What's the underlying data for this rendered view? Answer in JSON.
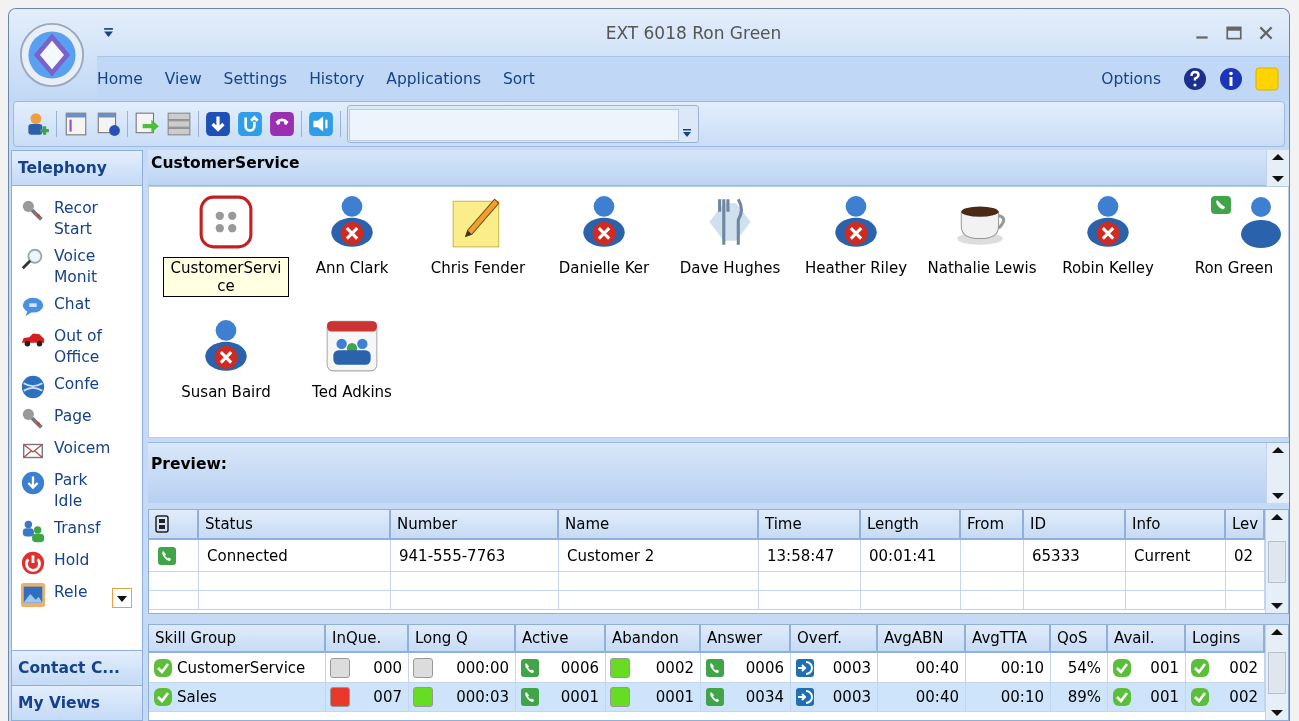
{
  "window": {
    "title": "EXT 6018 Ron Green"
  },
  "menu": [
    "Home",
    "View",
    "Settings",
    "History",
    "Applications",
    "Sort"
  ],
  "options": "Options",
  "sidebar": {
    "active_section": "Telephony",
    "items": [
      {
        "kind": "microphone",
        "lines": [
          "Recor",
          "Start"
        ]
      },
      {
        "kind": "magnifier",
        "lines": [
          "Voice",
          "Monit"
        ]
      },
      {
        "kind": "chat",
        "lines": [
          "Chat"
        ]
      },
      {
        "kind": "car",
        "lines": [
          "Out of",
          "Office"
        ]
      },
      {
        "kind": "conference",
        "lines": [
          "Confe"
        ]
      },
      {
        "kind": "microphone",
        "lines": [
          "Page"
        ]
      },
      {
        "kind": "envelope",
        "lines": [
          "Voicem"
        ]
      },
      {
        "kind": "park",
        "lines": [
          "Park",
          "Idle"
        ]
      },
      {
        "kind": "transfer",
        "lines": [
          "Transf"
        ]
      },
      {
        "kind": "hold",
        "lines": [
          "Hold"
        ]
      },
      {
        "kind": "release",
        "lines": [
          "Rele"
        ]
      }
    ],
    "other_sections": [
      "Contact C...",
      "My Views"
    ]
  },
  "group_panel": {
    "title": "CustomerService",
    "contacts": [
      {
        "name": "CustomerService",
        "kind": "group",
        "selected": true
      },
      {
        "name": "Ann Clark",
        "kind": "busy",
        "selected": false
      },
      {
        "name": "Chris Fender",
        "kind": "note",
        "selected": false
      },
      {
        "name": "Danielle Ker",
        "kind": "busy",
        "selected": false
      },
      {
        "name": "Dave Hughes",
        "kind": "dining",
        "selected": false
      },
      {
        "name": "Heather Riley",
        "kind": "busy",
        "selected": false
      },
      {
        "name": "Nathalie Lewis",
        "kind": "coffee",
        "selected": false
      },
      {
        "name": "Robin Kelley",
        "kind": "busy",
        "selected": false
      },
      {
        "name": "Ron Green",
        "kind": "on-phone",
        "selected": false
      },
      {
        "name": "Susan Baird",
        "kind": "busy",
        "selected": false
      },
      {
        "name": "Ted Adkins",
        "kind": "meeting",
        "selected": false
      }
    ]
  },
  "preview": {
    "title": "Preview:",
    "columns": [
      "Status",
      "Number",
      "Name",
      "Time",
      "Length",
      "From",
      "ID",
      "Info",
      "Lev"
    ],
    "rows": [
      {
        "kind": "phone",
        "cells": [
          "Connected",
          "941-555-7763",
          "Customer 2",
          "13:58:47",
          "00:01:41",
          null,
          "65333",
          "Current",
          "02"
        ]
      }
    ]
  },
  "skills": {
    "columns": [
      "Skill Group",
      "InQue.",
      "Long Q",
      "Active",
      "Abandon",
      "Answer",
      "Overf.",
      "AvgABN",
      "AvgTTA",
      "QoS",
      "Avail.",
      "Logins"
    ],
    "rows": [
      {
        "selected": false,
        "cells": [
          {
            "kind": "check",
            "text": "CustomerService"
          },
          {
            "color": "#dcdcdc",
            "text": "000"
          },
          {
            "color": "#dcdcdc",
            "text": "000:00"
          },
          {
            "kind": "phone",
            "text": "0006"
          },
          {
            "color": "#66dd22",
            "text": "0002"
          },
          {
            "kind": "phone",
            "text": "0006"
          },
          {
            "kind": "overflow",
            "text": "0003"
          },
          {
            "text": "00:40"
          },
          {
            "text": "00:10"
          },
          {
            "text": "54%"
          },
          {
            "kind": "check",
            "text": "001"
          },
          {
            "kind": "check",
            "text": "002"
          }
        ]
      },
      {
        "selected": true,
        "cells": [
          {
            "kind": "check",
            "text": "Sales"
          },
          {
            "color": "#e8392a",
            "text": "007"
          },
          {
            "color": "#66dd22",
            "text": "000:03"
          },
          {
            "kind": "phone",
            "text": "0001"
          },
          {
            "color": "#66dd22",
            "text": "0001"
          },
          {
            "kind": "phone",
            "text": "0034"
          },
          {
            "kind": "overflow",
            "text": "0003"
          },
          {
            "text": "00:40"
          },
          {
            "text": "00:10"
          },
          {
            "text": "89%"
          },
          {
            "kind": "check",
            "text": "001"
          },
          {
            "kind": "check",
            "text": "002"
          }
        ]
      }
    ]
  }
}
